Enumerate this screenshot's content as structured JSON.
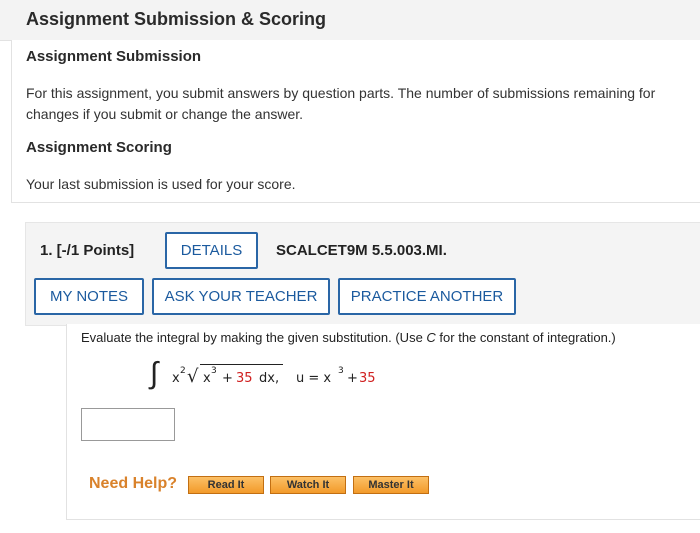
{
  "header": {
    "title": "Assignment Submission & Scoring"
  },
  "submission": {
    "heading": "Assignment Submission",
    "line1": "For this assignment, you submit answers by question parts. The number of submissions remaining for",
    "line2": "changes if you submit or change the answer."
  },
  "scoring": {
    "heading": "Assignment Scoring",
    "text": "Your last submission is used for your score."
  },
  "question": {
    "number_points": "1.  [-/1 Points]",
    "details_label": "DETAILS",
    "code": "SCALCET9M 5.5.003.MI.",
    "my_notes_label": "MY NOTES",
    "ask_teacher_label": "ASK YOUR TEACHER",
    "practice_label": "PRACTICE ANOTHER",
    "prompt_a": "Evaluate the integral by making the given substitution. (Use ",
    "prompt_c": "C",
    "prompt_b": " for the constant of integration.)",
    "integral_sign": "∫",
    "x": "x",
    "exp2": "2",
    "sqrt": "√",
    "exp3": "3",
    "plus": "+",
    "const": "35",
    "dx": "dx,",
    "u_eq": "u = x",
    "u_exp": "3",
    "u_plus": "+",
    "u_const": "35",
    "answer_value": ""
  },
  "help": {
    "label": "Need Help?",
    "read_it": "Read It",
    "watch_it": "Watch It",
    "master_it": "Master It"
  },
  "colors": {
    "button_border": "#2a66a6",
    "button_text": "#1b5a9e",
    "highlight_red": "#d02020",
    "help_orange": "#d9822b",
    "help_button": "#f29a2a"
  }
}
